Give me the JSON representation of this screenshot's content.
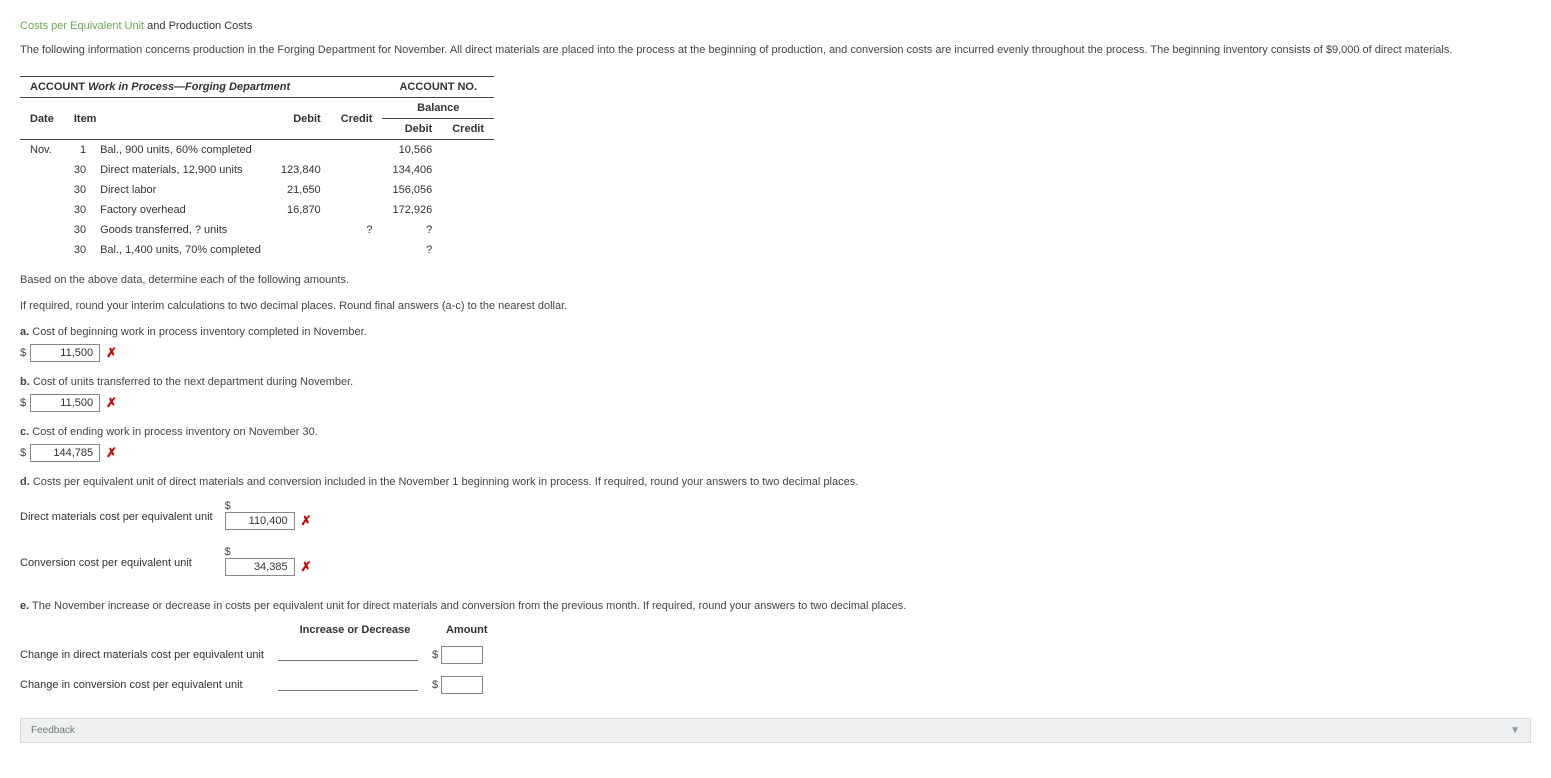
{
  "title": {
    "green": "Costs per Equivalent Unit",
    "rest": " and Production Costs"
  },
  "intro": "The following information concerns production in the Forging Department for November. All direct materials are placed into the process at the beginning of production, and conversion costs are incurred evenly throughout the process. The beginning inventory consists of $9,000 of direct materials.",
  "ledger": {
    "account_label": "ACCOUNT",
    "account_name": "Work in Process—Forging Department",
    "account_no_label": "ACCOUNT NO.",
    "headers": {
      "date": "Date",
      "item": "Item",
      "debit": "Debit",
      "credit": "Credit",
      "balance": "Balance",
      "bal_debit": "Debit",
      "bal_credit": "Credit"
    },
    "rows": [
      {
        "date": "Nov.",
        "day": "1",
        "item": "Bal., 900 units, 60% completed",
        "debit": "",
        "credit": "",
        "bdebit": "10,566",
        "bcredit": ""
      },
      {
        "date": "",
        "day": "30",
        "item": "Direct materials, 12,900 units",
        "debit": "123,840",
        "credit": "",
        "bdebit": "134,406",
        "bcredit": ""
      },
      {
        "date": "",
        "day": "30",
        "item": "Direct labor",
        "debit": "21,650",
        "credit": "",
        "bdebit": "156,056",
        "bcredit": ""
      },
      {
        "date": "",
        "day": "30",
        "item": "Factory overhead",
        "debit": "16,870",
        "credit": "",
        "bdebit": "172,926",
        "bcredit": ""
      },
      {
        "date": "",
        "day": "30",
        "item": "Goods transferred, ? units",
        "debit": "",
        "credit": "?",
        "bdebit": "?",
        "bcredit": ""
      },
      {
        "date": "",
        "day": "30",
        "item": "Bal., 1,400 units, 70% completed",
        "debit": "",
        "credit": "",
        "bdebit": "?",
        "bcredit": ""
      }
    ]
  },
  "instr1": "Based on the above data, determine each of the following amounts.",
  "instr2": "If required, round your interim calculations to two decimal places. Round final answers (a-c) to the nearest dollar.",
  "qa": {
    "label": "a.",
    "text": "Cost of beginning work in process inventory completed in November.",
    "value": "11,500"
  },
  "qb": {
    "label": "b.",
    "text": "Cost of units transferred to the next department during November.",
    "value": "11,500"
  },
  "qc": {
    "label": "c.",
    "text": "Cost of ending work in process inventory on November 30.",
    "value": "144,785"
  },
  "qd": {
    "label": "d.",
    "text": "Costs per equivalent unit of direct materials and conversion included in the November 1 beginning work in process. If required, round your answers to two decimal places.",
    "row1_label": "Direct materials cost per equivalent unit",
    "row1_value": "110,400",
    "row2_label": "Conversion cost per equivalent unit",
    "row2_value": "34,385"
  },
  "qe": {
    "label": "e.",
    "text": "The November increase or decrease in costs per equivalent unit for direct materials and conversion from the previous month. If required, round your answers to two decimal places.",
    "col1": "Increase or Decrease",
    "col2": "Amount",
    "row1": "Change in direct materials cost per equivalent unit",
    "row2": "Change in conversion cost per equivalent unit"
  },
  "feedback": "Feedback",
  "dollar": "$",
  "x": "✗"
}
